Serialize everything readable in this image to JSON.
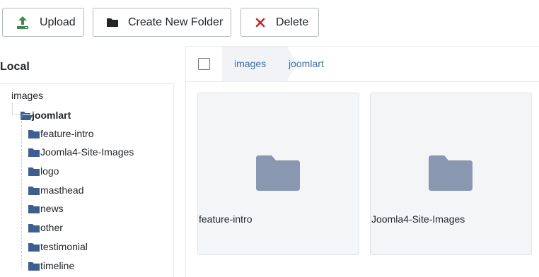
{
  "toolbar": {
    "upload_label": "Upload",
    "create_folder_label": "Create New Folder",
    "delete_label": "Delete"
  },
  "sidebar": {
    "title": "Local",
    "root": "images",
    "current": "joomlart",
    "children": [
      "feature-intro",
      "Joomla4-Site-Images",
      "logo",
      "masthead",
      "news",
      "other",
      "testimonial",
      "timeline"
    ]
  },
  "breadcrumb": [
    "images",
    "joomlart"
  ],
  "items": [
    {
      "name": "feature-intro",
      "type": "folder"
    },
    {
      "name": "Joomla4-Site-Images",
      "type": "folder"
    }
  ],
  "icons": {
    "upload": "upload-icon",
    "folder": "folder-icon",
    "folder_open": "folder-open-icon",
    "delete": "close-icon"
  },
  "colors": {
    "upload_icon": "#3f8a4e",
    "delete_icon": "#c52827",
    "tree_folder": "#3d5f8f",
    "tile_folder": "#8a97b0",
    "link": "#3f6ea6",
    "breadcrumb_bg": "#f1f3f6"
  }
}
